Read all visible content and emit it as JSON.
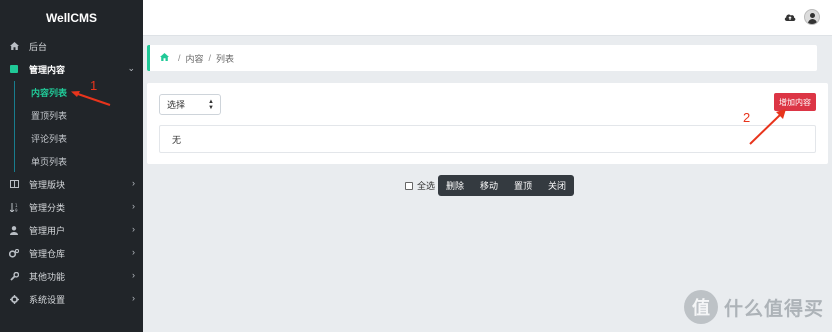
{
  "app": {
    "brand": "WellCMS"
  },
  "sidebar": {
    "items": [
      {
        "label": "后台",
        "icon": "home-icon",
        "chevron": ""
      },
      {
        "label": "管理内容",
        "icon": "edit-icon",
        "chevron": "⌄"
      },
      {
        "label": "管理版块",
        "icon": "columns-icon",
        "chevron": "›"
      },
      {
        "label": "管理分类",
        "icon": "sort-icon",
        "chevron": "›"
      },
      {
        "label": "管理用户",
        "icon": "user-icon",
        "chevron": "›"
      },
      {
        "label": "管理仓库",
        "icon": "cogs-icon",
        "chevron": "›"
      },
      {
        "label": "其他功能",
        "icon": "wrench-icon",
        "chevron": "›"
      },
      {
        "label": "系统设置",
        "icon": "gear-icon",
        "chevron": "›"
      }
    ],
    "sub_items": [
      {
        "label": "内容列表"
      },
      {
        "label": "置顶列表"
      },
      {
        "label": "评论列表"
      },
      {
        "label": "单页列表"
      }
    ]
  },
  "breadcrumb": {
    "items": [
      "内容",
      "列表"
    ],
    "separator": "/"
  },
  "toolbar": {
    "select_value": "选择",
    "add_label": "增加内容"
  },
  "content": {
    "empty_text": "无"
  },
  "bulk": {
    "select_all_label": "全选",
    "actions": [
      "删除",
      "移动",
      "置顶",
      "关闭"
    ]
  },
  "annotations": {
    "one": "1",
    "two": "2"
  },
  "watermark": {
    "logo_char": "值",
    "text": "什么值得买"
  },
  "colors": {
    "accent": "#20c997",
    "danger": "#dc3545",
    "annotation": "#e8341c",
    "sidebar_bg": "#212529"
  }
}
